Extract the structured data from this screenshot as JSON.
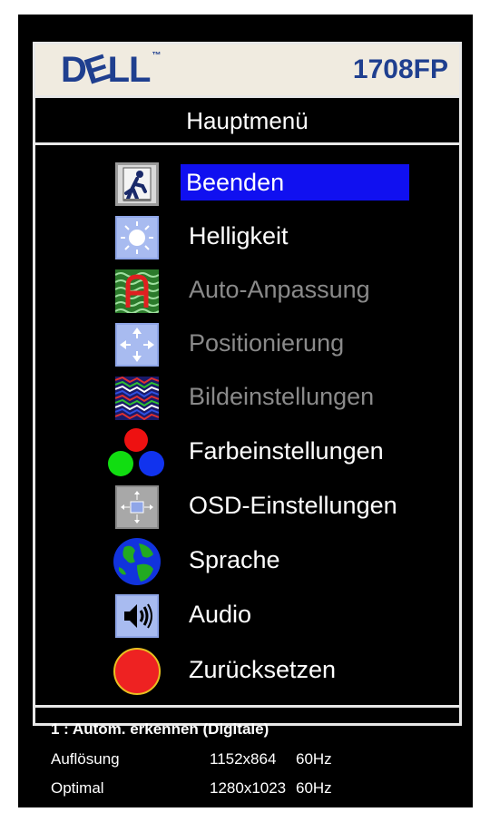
{
  "header": {
    "logo_text": "DELL",
    "trademark": "™",
    "model": "1708FP"
  },
  "title": "Hauptmenü",
  "menu": {
    "items": [
      {
        "label": "Beenden",
        "icon": "exit-icon",
        "state": "selected"
      },
      {
        "label": "Helligkeit",
        "icon": "brightness-icon",
        "state": "enabled"
      },
      {
        "label": "Auto-Anpassung",
        "icon": "auto-adjust-icon",
        "state": "disabled"
      },
      {
        "label": "Positionierung",
        "icon": "position-icon",
        "state": "disabled"
      },
      {
        "label": "Bildeinstellungen",
        "icon": "image-settings-icon",
        "state": "disabled"
      },
      {
        "label": "Farbeinstellungen",
        "icon": "color-settings-icon",
        "state": "enabled"
      },
      {
        "label": "OSD-Einstellungen",
        "icon": "osd-settings-icon",
        "state": "enabled"
      },
      {
        "label": "Sprache",
        "icon": "language-globe-icon",
        "state": "enabled"
      },
      {
        "label": "Audio",
        "icon": "audio-speaker-icon",
        "state": "enabled"
      },
      {
        "label": "Zurücksetzen",
        "icon": "reset-icon",
        "state": "enabled"
      }
    ]
  },
  "footer": {
    "input_line": "1 : Autom. erkennen (Digitale)",
    "resolution_label": "Auflösung",
    "resolution_value": "1152x864",
    "resolution_rate": "60Hz",
    "optimal_label": "Optimal",
    "optimal_value": "1280x1023",
    "optimal_rate": "60Hz"
  },
  "colors": {
    "brand_blue": "#1f3f8f",
    "selection_blue": "#1010f0",
    "osd_background": "#000000",
    "disabled_text": "#8a8a8a"
  }
}
